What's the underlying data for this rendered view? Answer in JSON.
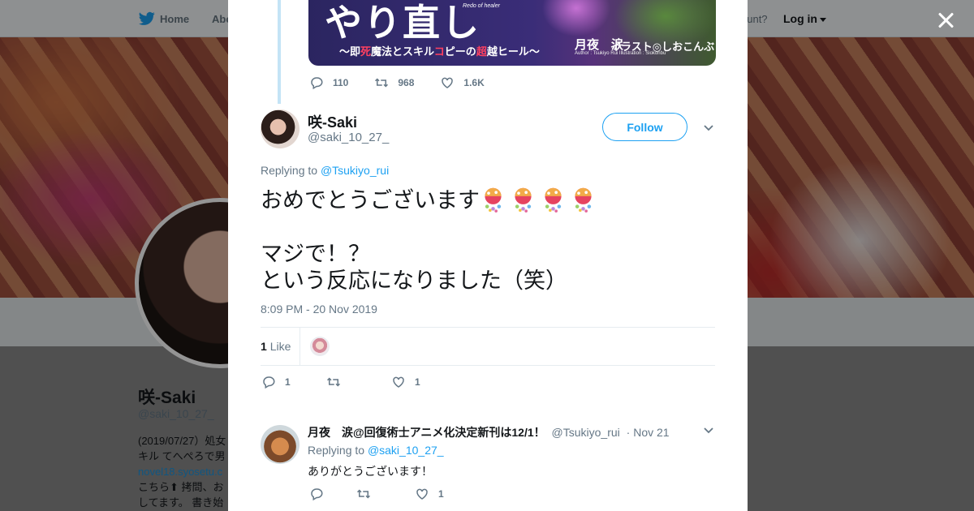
{
  "background": {
    "nav": {
      "home_label": "Home",
      "about_label": "Abo",
      "have_account": "ccount?",
      "login_label": "Log in"
    },
    "profile": {
      "name": "咲-Saki",
      "handle": "@saki_10_27_",
      "bio_lines": [
        "(2019/07/27）処女",
        "キル てへぺろで男",
        "novel18.syosetu.c",
        "こちら⬆ 拷問、お",
        "してます。 書き始"
      ]
    }
  },
  "modal": {
    "close_label": "×",
    "parent_tweet": {
      "card": {
        "title": "やり直し",
        "title_en": "Redo of healer",
        "subtitle_pre": "〜即",
        "subtitle_red1": "死",
        "subtitle_mid": "魔法とスキル",
        "subtitle_red2": "コ",
        "subtitle_mid2": "ピーの",
        "subtitle_red3": "超",
        "subtitle_post": "越ヒール〜",
        "author": "月夜　涙",
        "illustrator": "イラスト◎しおこんぶ",
        "credit": "Author : Tsukiyo Rui    Illustration : Siokonbu"
      },
      "replies": "110",
      "retweets": "968",
      "likes": "1.6K"
    },
    "main_tweet": {
      "name": "咲-Saki",
      "handle": "@saki_10_27_",
      "follow_label": "Follow",
      "replying_to_prefix": "Replying to ",
      "replying_to_handle": "@Tsukiyo_rui",
      "text_line1": "おめでとうございます",
      "emoji_name": "confetti-ball-emoji",
      "text_line2": "マジで！？",
      "text_line3": "という反応になりました（笑）",
      "timestamp": "8:09 PM - 20 Nov 2019",
      "like_count": "1",
      "like_label": "Like",
      "replies": "1",
      "retweets": "",
      "likes": "1"
    },
    "reply_tweet": {
      "name": "月夜　涙@回復術士アニメ化決定新刊は12/1！",
      "handle": "@Tsukiyo_rui",
      "date": "· Nov 21",
      "replying_to_prefix": "Replying to ",
      "replying_to_handle": "@saki_10_27_",
      "text": "ありがとうございます！",
      "replies": "",
      "retweets": "",
      "likes": "1"
    }
  },
  "colors": {
    "accent": "#1da1f2",
    "text": "#14171a",
    "muted": "#657786",
    "thread_line": "#c4e4f6"
  }
}
